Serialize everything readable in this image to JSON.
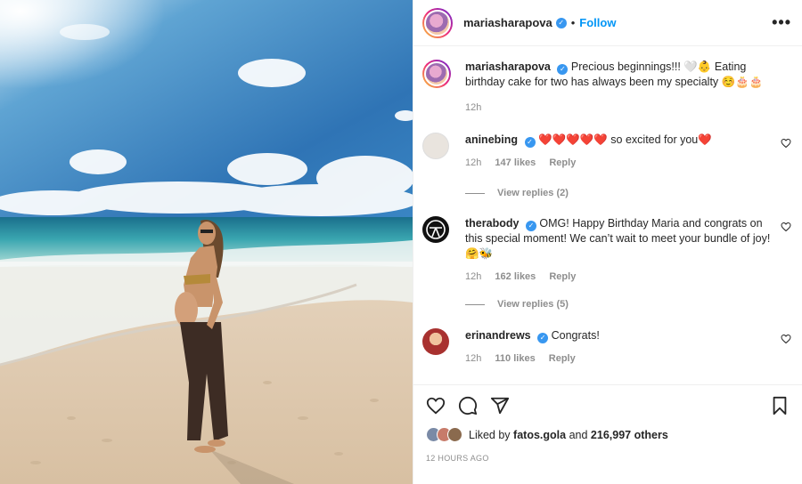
{
  "header": {
    "username": "mariasharapova",
    "separator": "•",
    "follow_label": "Follow",
    "more_label": "•••"
  },
  "caption": {
    "username": "mariasharapova",
    "text": "Precious beginnings!!! 🤍👶 Eating birthday cake for two has always been my specialty ☺️🎂🎂",
    "time": "12h"
  },
  "comments": [
    {
      "username": "aninebing",
      "text": "❤️❤️❤️❤️❤️ so excited for you❤️",
      "time": "12h",
      "likes": "147 likes",
      "reply": "Reply",
      "view_replies": "View replies (2)",
      "avatar_color": "#e9e4de"
    },
    {
      "username": "therabody",
      "text": "OMG! Happy Birthday Maria and congrats on this special moment! We can’t wait to meet your bundle of joy! 🤗🐝",
      "time": "12h",
      "likes": "162 likes",
      "reply": "Reply",
      "view_replies": "View replies (5)",
      "avatar_color": "#111111"
    },
    {
      "username": "erinandrews",
      "text": "Congrats!",
      "time": "12h",
      "likes": "110 likes",
      "reply": "Reply",
      "avatar_color": "#a8312f"
    }
  ],
  "likes": {
    "prefix": "Liked by",
    "user": "fatos.gola",
    "connector": "and",
    "count": "216,997 others"
  },
  "timestamp": "12 HOURS AGO",
  "icons": [
    "more-icon",
    "verified-icon",
    "heart-icon",
    "comment-icon",
    "share-icon",
    "bookmark-icon"
  ],
  "colors": {
    "link": "#0095f6",
    "verified": "#3897f0",
    "muted": "#8e8e8e",
    "text": "#262626"
  }
}
